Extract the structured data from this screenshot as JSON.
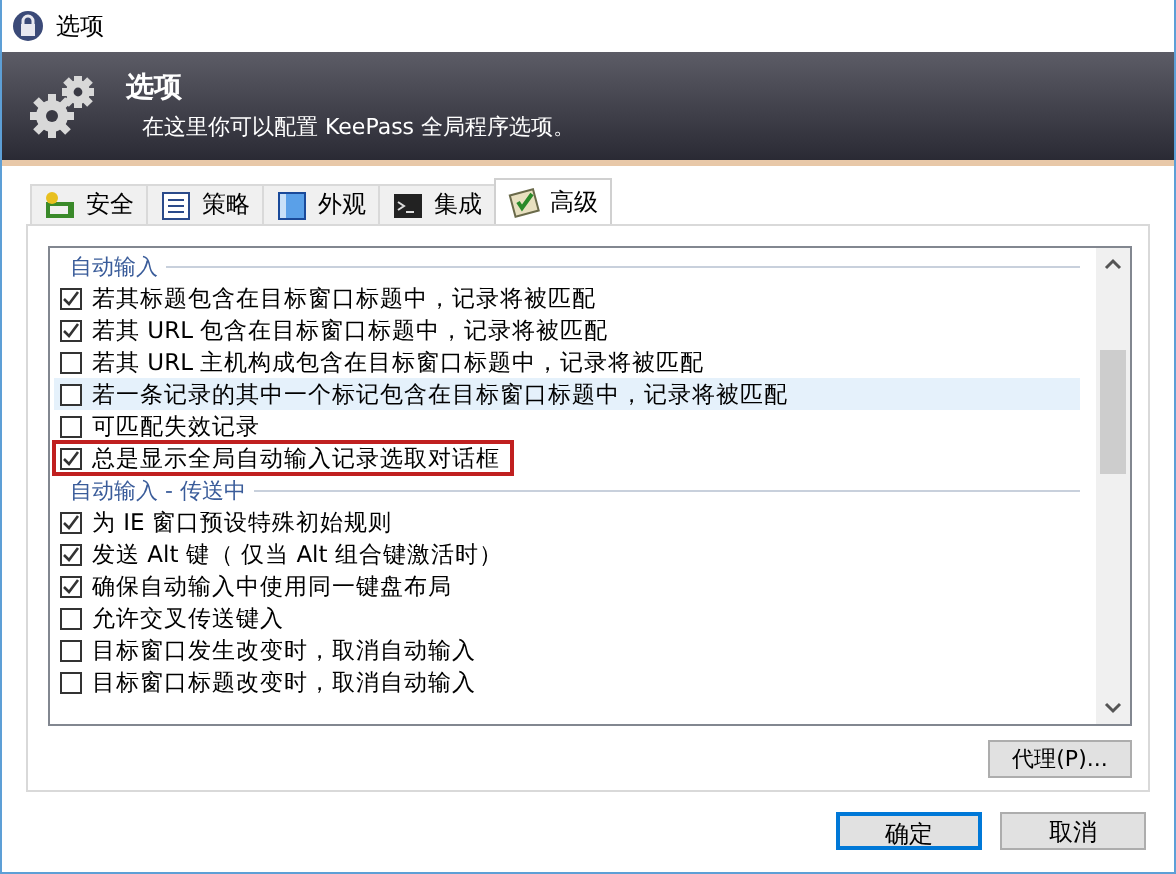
{
  "window": {
    "title": "选项"
  },
  "header": {
    "title": "选项",
    "subtitle": "在这里你可以配置 KeePass 全局程序选项。"
  },
  "tabs": [
    {
      "label": "安全",
      "kind": "security",
      "selected": false
    },
    {
      "label": "策略",
      "kind": "policy",
      "selected": false
    },
    {
      "label": "外观",
      "kind": "interface",
      "selected": false
    },
    {
      "label": "集成",
      "kind": "integration",
      "selected": false
    },
    {
      "label": "高级",
      "kind": "advanced",
      "selected": true
    }
  ],
  "groups": [
    {
      "title": "自动输入",
      "items": [
        {
          "label": "若其标题包含在目标窗口标题中，记录将被匹配",
          "checked": true,
          "highlighted": false,
          "marked": false
        },
        {
          "label": "若其 URL 包含在目标窗口标题中，记录将被匹配",
          "checked": true,
          "highlighted": false,
          "marked": false
        },
        {
          "label": "若其 URL 主机构成包含在目标窗口标题中，记录将被匹配",
          "checked": false,
          "highlighted": false,
          "marked": false
        },
        {
          "label": "若一条记录的其中一个标记包含在目标窗口标题中，记录将被匹配",
          "checked": false,
          "highlighted": true,
          "marked": false
        },
        {
          "label": "可匹配失效记录",
          "checked": false,
          "highlighted": false,
          "marked": false
        },
        {
          "label": "总是显示全局自动输入记录选取对话框",
          "checked": true,
          "highlighted": false,
          "marked": true
        }
      ]
    },
    {
      "title": "自动输入 - 传送中",
      "items": [
        {
          "label": "为 IE 窗口预设特殊初始规则",
          "checked": true,
          "highlighted": false,
          "marked": false
        },
        {
          "label": "发送 Alt 键（ 仅当 Alt 组合键激活时）",
          "checked": true,
          "highlighted": false,
          "marked": false
        },
        {
          "label": "确保自动输入中使用同一键盘布局",
          "checked": true,
          "highlighted": false,
          "marked": false
        },
        {
          "label": "允许交叉传送键入",
          "checked": false,
          "highlighted": false,
          "marked": false
        },
        {
          "label": "目标窗口发生改变时，取消自动输入",
          "checked": false,
          "highlighted": false,
          "marked": false
        },
        {
          "label": "目标窗口标题改变时，取消自动输入",
          "checked": false,
          "highlighted": false,
          "marked": false
        }
      ]
    }
  ],
  "proxy_button": "代理(P)...",
  "buttons": [
    {
      "label": "确定",
      "selected": true
    },
    {
      "label": "取消",
      "selected": false
    }
  ]
}
